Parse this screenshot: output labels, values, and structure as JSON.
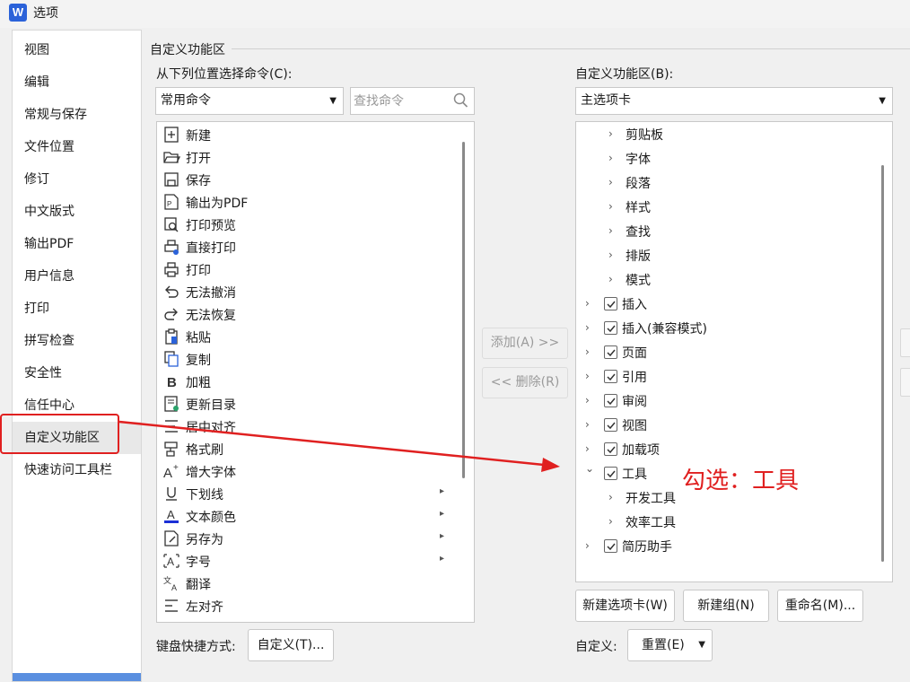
{
  "window": {
    "title": "选项",
    "logo_letter": "W"
  },
  "sidebar": {
    "items": [
      {
        "label": "视图"
      },
      {
        "label": "编辑"
      },
      {
        "label": "常规与保存"
      },
      {
        "label": "文件位置"
      },
      {
        "label": "修订"
      },
      {
        "label": "中文版式"
      },
      {
        "label": "输出PDF"
      },
      {
        "label": "用户信息"
      },
      {
        "label": "打印"
      },
      {
        "label": "拼写检查"
      },
      {
        "label": "安全性"
      },
      {
        "label": "信任中心"
      },
      {
        "label": "自定义功能区"
      },
      {
        "label": "快速访问工具栏"
      }
    ],
    "selected": "自定义功能区"
  },
  "main": {
    "group_title": "自定义功能区",
    "choose_label": "从下列位置选择命令(C):",
    "choose_value": "常用命令",
    "search_placeholder": "查找命令",
    "commands": [
      {
        "label": "新建",
        "icon": "new-doc-icon"
      },
      {
        "label": "打开",
        "icon": "folder-open-icon"
      },
      {
        "label": "保存",
        "icon": "save-icon"
      },
      {
        "label": "输出为PDF",
        "icon": "export-pdf-icon"
      },
      {
        "label": "打印预览",
        "icon": "print-preview-icon"
      },
      {
        "label": "直接打印",
        "icon": "quick-print-icon"
      },
      {
        "label": "打印",
        "icon": "printer-icon"
      },
      {
        "label": "无法撤消",
        "icon": "undo-icon"
      },
      {
        "label": "无法恢复",
        "icon": "redo-icon"
      },
      {
        "label": "粘贴",
        "icon": "paste-icon"
      },
      {
        "label": "复制",
        "icon": "copy-icon"
      },
      {
        "label": "加粗",
        "icon": "bold-icon"
      },
      {
        "label": "更新目录",
        "icon": "update-toc-icon"
      },
      {
        "label": "居中对齐",
        "icon": "align-center-icon"
      },
      {
        "label": "格式刷",
        "icon": "format-painter-icon"
      },
      {
        "label": "增大字体",
        "icon": "increase-font-icon"
      },
      {
        "label": "下划线",
        "icon": "underline-icon",
        "submenu": true
      },
      {
        "label": "文本颜色",
        "icon": "text-color-icon",
        "submenu": true
      },
      {
        "label": "另存为",
        "icon": "save-as-icon",
        "submenu": true
      },
      {
        "label": "字号",
        "icon": "font-size-icon",
        "submenu": true
      },
      {
        "label": "翻译",
        "icon": "translate-icon"
      },
      {
        "label": "左对齐",
        "icon": "align-left-icon"
      }
    ],
    "add_label": "添加(A) >>",
    "remove_label": "<< 删除(R)",
    "ribbon_label": "自定义功能区(B):",
    "ribbon_value": "主选项卡",
    "tree": [
      {
        "label": "剪贴板",
        "level": 1,
        "checkbox": false,
        "expanded": false
      },
      {
        "label": "字体",
        "level": 1,
        "checkbox": false,
        "expanded": false
      },
      {
        "label": "段落",
        "level": 1,
        "checkbox": false,
        "expanded": false
      },
      {
        "label": "样式",
        "level": 1,
        "checkbox": false,
        "expanded": false
      },
      {
        "label": "查找",
        "level": 1,
        "checkbox": false,
        "expanded": false
      },
      {
        "label": "排版",
        "level": 1,
        "checkbox": false,
        "expanded": false
      },
      {
        "label": "模式",
        "level": 1,
        "checkbox": false,
        "expanded": false
      },
      {
        "label": "插入",
        "level": 0,
        "checkbox": true,
        "expanded": false
      },
      {
        "label": "插入(兼容模式)",
        "level": 0,
        "checkbox": true,
        "expanded": false
      },
      {
        "label": "页面",
        "level": 0,
        "checkbox": true,
        "expanded": false
      },
      {
        "label": "引用",
        "level": 0,
        "checkbox": true,
        "expanded": false
      },
      {
        "label": "审阅",
        "level": 0,
        "checkbox": true,
        "expanded": false
      },
      {
        "label": "视图",
        "level": 0,
        "checkbox": true,
        "expanded": false
      },
      {
        "label": "加载项",
        "level": 0,
        "checkbox": true,
        "expanded": false
      },
      {
        "label": "工具",
        "level": 0,
        "checkbox": true,
        "expanded": true
      },
      {
        "label": "开发工具",
        "level": 1,
        "checkbox": false,
        "expanded": false
      },
      {
        "label": "效率工具",
        "level": 1,
        "checkbox": false,
        "expanded": false
      },
      {
        "label": "简历助手",
        "level": 0,
        "checkbox": true,
        "expanded": false
      }
    ],
    "new_tab_label": "新建选项卡(W)",
    "new_group_label": "新建组(N)",
    "rename_label": "重命名(M)...",
    "keyboard_label": "键盘快捷方式:",
    "customize_label": "自定义(T)...",
    "custom_label": "自定义:",
    "reset_label": "重置(E)"
  },
  "annotation": {
    "text": "勾选：工具",
    "color": "#e02020"
  },
  "colors": {
    "accent": "#5a8fe0",
    "annotation": "#e02020",
    "checkmark": "#333333"
  }
}
